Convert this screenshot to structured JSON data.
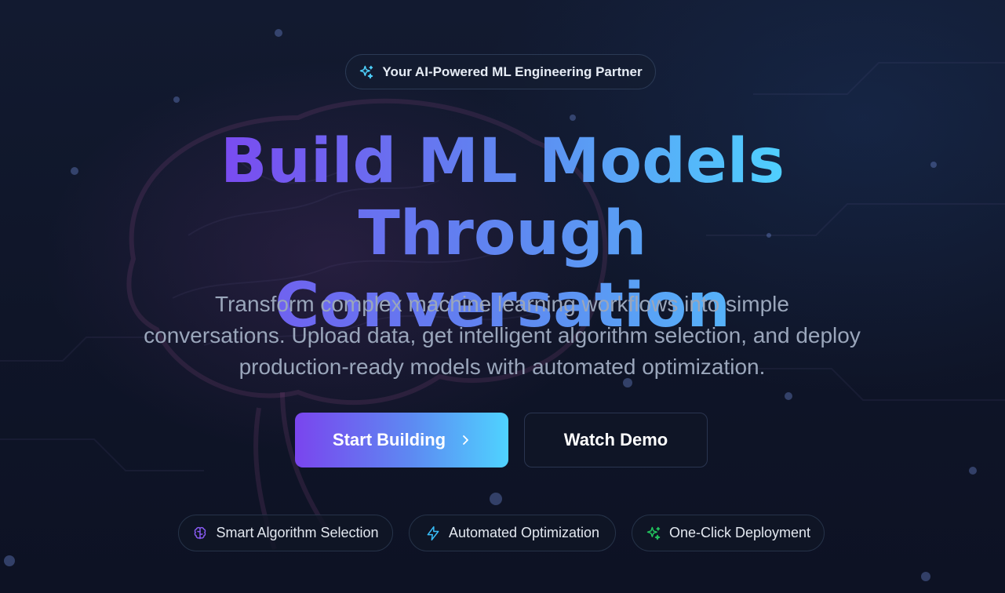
{
  "badge": {
    "icon": "sparkles-icon",
    "label": "Your AI-Powered ML Engineering Partner"
  },
  "headline": {
    "line1": "Build ML Models",
    "line2": "Through Conversation",
    "gradient": [
      "#7a4bf0",
      "#5f86f0",
      "#4fd0ff"
    ]
  },
  "subtitle": "Transform complex machine learning workflows into simple conversations. Upload data, get intelligent algorithm selection, and deploy production-ready models with automated optimization.",
  "buttons": {
    "primary_label": "Start Building",
    "primary_icon": "chevron-right-icon",
    "secondary_label": "Watch Demo"
  },
  "features": [
    {
      "label": "Smart Algorithm Selection",
      "icon": "brain-icon",
      "color": "#8b5cf6"
    },
    {
      "label": "Automated Optimization",
      "icon": "lightning-icon",
      "color": "#38bdf8"
    },
    {
      "label": "One-Click Deployment",
      "icon": "sparkles-icon",
      "color": "#22c55e"
    }
  ]
}
